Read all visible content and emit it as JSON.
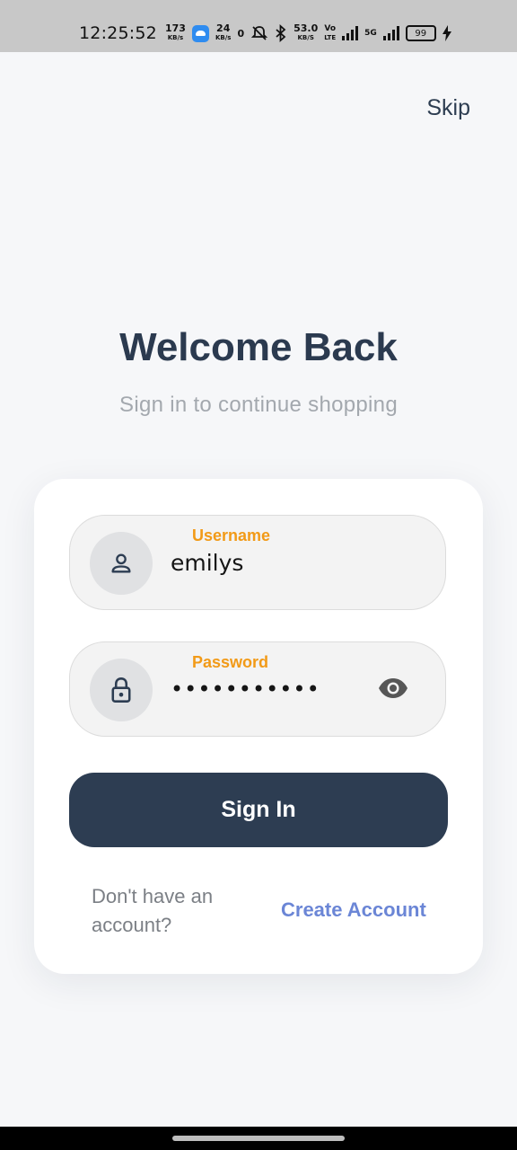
{
  "status_bar": {
    "time": "12:25:52",
    "speeds": [
      {
        "value": "173",
        "unit": "KB/s"
      },
      {
        "value": "24",
        "unit": "KB/s"
      },
      {
        "value": "53.0",
        "unit": "KB/S"
      }
    ],
    "data_saver": "0",
    "volte": "Vo\nLTE",
    "network": "5G",
    "battery": "99",
    "icons": [
      "app-icon",
      "mute-icon",
      "bluetooth-icon",
      "signal-icon",
      "battery-icon",
      "charging-icon"
    ]
  },
  "header": {
    "skip_label": "Skip"
  },
  "hero": {
    "title": "Welcome Back",
    "subtitle": "Sign in to continue shopping"
  },
  "form": {
    "username": {
      "label": "Username",
      "value": "emilys",
      "icon": "user-icon"
    },
    "password": {
      "label": "Password",
      "value": "•••••••••••",
      "icon": "lock-icon",
      "toggle_icon": "eye-icon"
    },
    "submit_label": "Sign In",
    "prompt_text": "Don't have an account?",
    "create_account_label": "Create Account"
  },
  "colors": {
    "background": "#f6f7f9",
    "primary": "#2d3d52",
    "label_accent": "#f29a17",
    "link": "#6b86d6",
    "card": "#ffffff"
  }
}
